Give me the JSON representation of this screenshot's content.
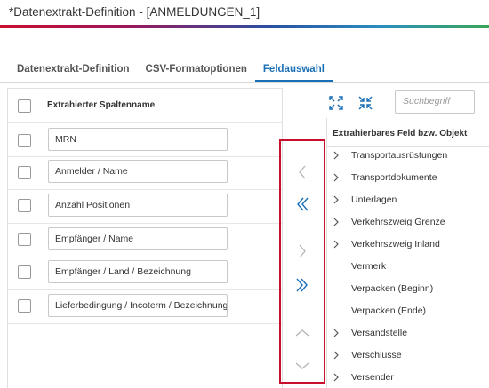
{
  "window": {
    "title": "*Datenextrakt-Definition - [ANMELDUNGEN_1]"
  },
  "tabs": [
    {
      "label": "Datenextrakt-Definition",
      "active": false
    },
    {
      "label": "CSV-Formatoptionen",
      "active": false
    },
    {
      "label": "Feldauswahl",
      "active": true
    }
  ],
  "left": {
    "header": "Extrahierter Spaltenname",
    "rows": [
      {
        "label": "MRN",
        "checked": false
      },
      {
        "label": "Anmelder / Name",
        "checked": false
      },
      {
        "label": "Anzahl Positionen",
        "checked": false
      },
      {
        "label": "Empfänger / Name",
        "checked": false
      },
      {
        "label": "Empfänger / Land / Bezeichnung",
        "checked": false
      },
      {
        "label": "Lieferbedingung / Incoterm / Bezeichnung",
        "checked": false
      }
    ]
  },
  "middle": {
    "buttons": [
      {
        "icon": "chevron-left-icon",
        "enabled": false
      },
      {
        "icon": "double-chevron-left-icon",
        "enabled": true
      },
      {
        "icon": "chevron-right-icon",
        "enabled": false
      },
      {
        "icon": "double-chevron-right-icon",
        "enabled": true
      },
      {
        "icon": "chevron-up-icon",
        "enabled": false
      },
      {
        "icon": "chevron-down-icon",
        "enabled": false
      }
    ]
  },
  "right": {
    "toolbar": {
      "expand_icon": "expand-all-icon",
      "collapse_icon": "collapse-all-icon"
    },
    "search": {
      "placeholder": "Suchbegriff"
    },
    "header": "Extrahierbares Feld bzw. Objekt",
    "items": [
      {
        "label": "Transportausrüstungen",
        "expandable": true
      },
      {
        "label": "Transportdokumente",
        "expandable": true
      },
      {
        "label": "Unterlagen",
        "expandable": true
      },
      {
        "label": "Verkehrszweig Grenze",
        "expandable": true
      },
      {
        "label": "Verkehrszweig Inland",
        "expandable": true
      },
      {
        "label": "Vermerk",
        "expandable": false
      },
      {
        "label": "Verpacken (Beginn)",
        "expandable": false
      },
      {
        "label": "Verpacken (Ende)",
        "expandable": false
      },
      {
        "label": "Versandstelle",
        "expandable": true
      },
      {
        "label": "Verschlüsse",
        "expandable": true
      },
      {
        "label": "Versender",
        "expandable": true
      }
    ]
  },
  "colors": {
    "accent": "#1a6fb7",
    "highlight_border": "#c8102e",
    "disabled_icon": "#b5b5b5"
  }
}
